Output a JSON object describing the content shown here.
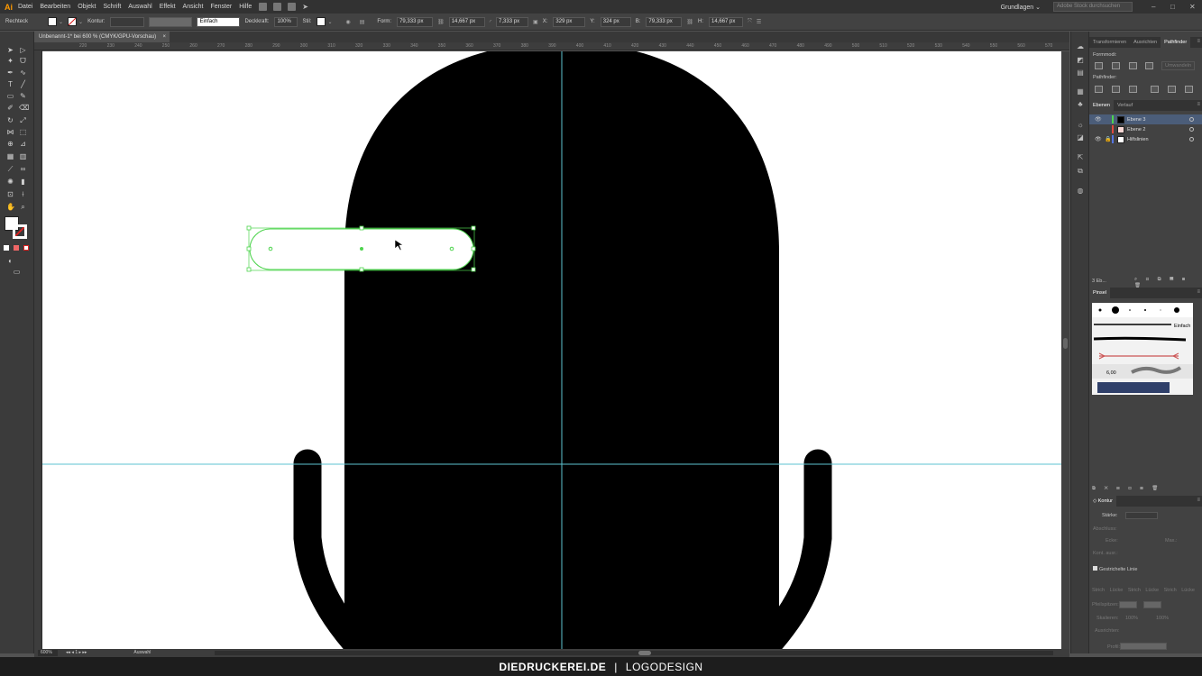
{
  "app": {
    "logo": "Ai"
  },
  "menu": {
    "items": [
      "Datei",
      "Bearbeiten",
      "Objekt",
      "Schrift",
      "Auswahl",
      "Effekt",
      "Ansicht",
      "Fenster",
      "Hilfe"
    ],
    "workspace": "Grundlagen",
    "stock_search_placeholder": "Adobe Stock durchsuchen"
  },
  "control_bar": {
    "selection_label": "Rechteck",
    "stroke_label": "Kontur:",
    "stroke_style": "Einfach",
    "opacity_label": "Deckkraft:",
    "opacity_value": "100%",
    "style_label": "Stil:",
    "shape_label": "Form:",
    "width_value": "79,333 px",
    "height_value": "14,667 px",
    "radius_value": "7,333 px",
    "x_label": "X:",
    "x_value": "329 px",
    "y_label": "Y:",
    "y_value": "324 px",
    "w_label": "B:",
    "w_value": "79,333 px",
    "h_label": "H:",
    "h_value": "14,667 px"
  },
  "document": {
    "tab_title": "Unbenannt-1* bei 600 % (CMYK/GPU-Vorschau)",
    "close": "×"
  },
  "ruler": {
    "h_ticks": [
      "220",
      "230",
      "240",
      "250",
      "260",
      "270",
      "280",
      "290",
      "300",
      "310",
      "320",
      "330",
      "340",
      "350",
      "360",
      "370",
      "380",
      "390",
      "400",
      "410",
      "420",
      "430",
      "440",
      "450",
      "460",
      "470",
      "480",
      "490",
      "500",
      "510",
      "520",
      "530",
      "540",
      "550",
      "560",
      "570",
      "580"
    ]
  },
  "status": {
    "zoom": "600%",
    "artboard": "1",
    "tool": "Auswahl"
  },
  "panels": {
    "top_tabs": [
      "Transformieren",
      "Ausrichten",
      "Pathfinder"
    ],
    "active_top_tab": "Pathfinder",
    "formmodi_label": "Formmodi:",
    "expand_button": "Umwandeln",
    "pathfinder_label": "Pathfinder:",
    "layer_tabs": [
      "Ebenen",
      "Verlauf"
    ],
    "layers": [
      {
        "name": "Ebene 3",
        "color": "#4ed44e",
        "selected": true,
        "visible": true,
        "locked": false
      },
      {
        "name": "Ebene 2",
        "color": "#e14a3f",
        "selected": false,
        "visible": false,
        "locked": false
      },
      {
        "name": "Hilfslinien",
        "color": "#5675e0",
        "selected": false,
        "visible": true,
        "locked": true
      }
    ],
    "layer_count": "3 Eb...",
    "brush_tab": "Pinsel",
    "brush_basic": "Einfach",
    "brush_size": "6,00",
    "stroke_tab": "Kontur",
    "stroke_weight_label": "Stärke:",
    "cap_label": "Abschluss:",
    "corner_label": "Ecke:",
    "limit_label": "Max.:",
    "align_label": "Kont. ausr.:",
    "dashed_label": "Gestrichelte Linie",
    "dash_labels": [
      "Strich",
      "Lücke",
      "Strich",
      "Lücke",
      "Strich",
      "Lücke"
    ],
    "arrow_label": "Pfeilspitzen:",
    "scale_label": "Skalieren:",
    "scale_value_1": "100%",
    "scale_value_2": "100%",
    "align_arrow_label": "Ausrichten:",
    "profile_label": "Profil:"
  },
  "footer": {
    "brand": "DIEDRUCKEREI.DE",
    "separator": "|",
    "topic": "LOGODESIGN"
  },
  "colors": {
    "guide": "#5ec3d0",
    "selection": "#4ed44e",
    "accent": "#ff9a00"
  }
}
